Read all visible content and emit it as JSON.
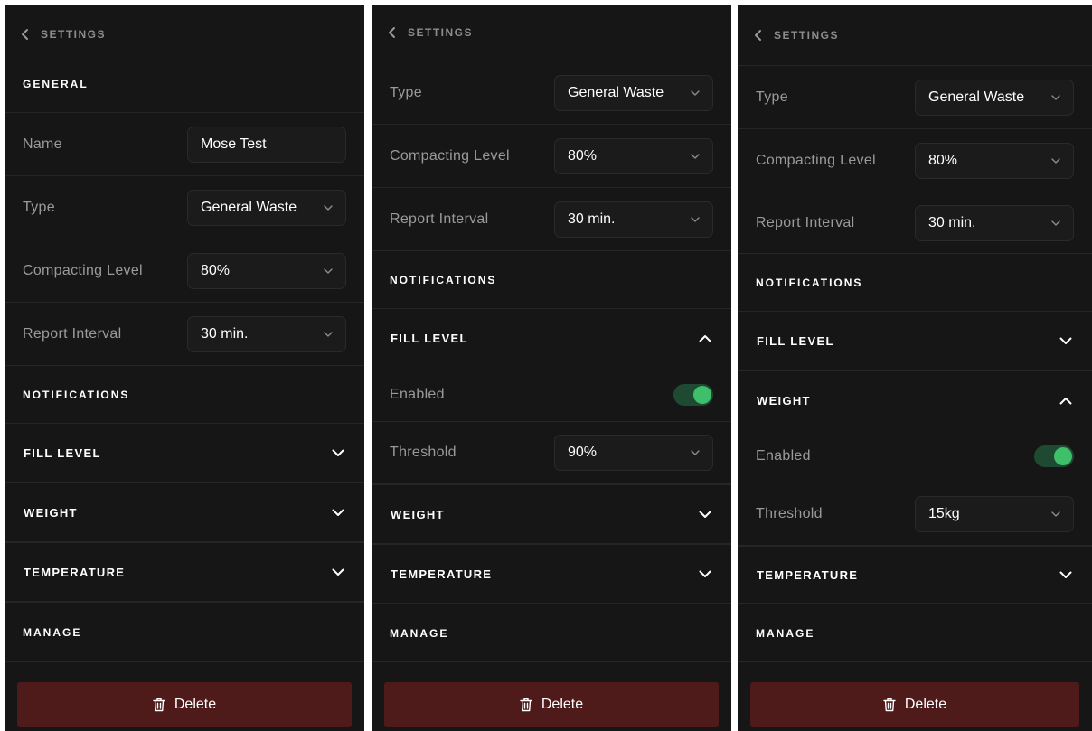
{
  "panels": [
    {
      "header": {
        "back_label": "SETTINGS"
      },
      "general": {
        "title": "GENERAL",
        "name_label": "Name",
        "name_value": "Mose Test"
      },
      "fields": {
        "type_label": "Type",
        "type_value": "General Waste",
        "compacting_label": "Compacting Level",
        "compacting_value": "80%",
        "interval_label": "Report Interval",
        "interval_value": "30 min."
      },
      "notifications_title": "NOTIFICATIONS",
      "fill_level": {
        "label": "FILL LEVEL",
        "expanded": false
      },
      "weight": {
        "label": "WEIGHT",
        "expanded": false
      },
      "temperature": {
        "label": "TEMPERATURE",
        "expanded": false
      },
      "manage_title": "MANAGE",
      "delete_label": "Delete"
    },
    {
      "header": {
        "back_label": "SETTINGS"
      },
      "fields": {
        "type_label": "Type",
        "type_value": "General Waste",
        "compacting_label": "Compacting Level",
        "compacting_value": "80%",
        "interval_label": "Report Interval",
        "interval_value": "30 min."
      },
      "notifications_title": "NOTIFICATIONS",
      "fill_level": {
        "label": "FILL LEVEL",
        "expanded": true,
        "enabled_label": "Enabled",
        "enabled": true,
        "threshold_label": "Threshold",
        "threshold_value": "90%"
      },
      "weight": {
        "label": "WEIGHT",
        "expanded": false
      },
      "temperature": {
        "label": "TEMPERATURE",
        "expanded": false
      },
      "manage_title": "MANAGE",
      "delete_label": "Delete"
    },
    {
      "header": {
        "back_label": "SETTINGS"
      },
      "fields": {
        "type_label": "Type",
        "type_value": "General Waste",
        "compacting_label": "Compacting Level",
        "compacting_value": "80%",
        "interval_label": "Report Interval",
        "interval_value": "30 min."
      },
      "notifications_title": "NOTIFICATIONS",
      "fill_level": {
        "label": "FILL LEVEL",
        "expanded": false
      },
      "weight": {
        "label": "WEIGHT",
        "expanded": true,
        "enabled_label": "Enabled",
        "enabled": true,
        "threshold_label": "Threshold",
        "threshold_value": "15kg"
      },
      "temperature": {
        "label": "TEMPERATURE",
        "expanded": false
      },
      "manage_title": "MANAGE",
      "delete_label": "Delete"
    }
  ],
  "colors": {
    "panel_bg": "#161616",
    "divider": "#262626",
    "toggle_track": "#1f4a32",
    "toggle_knob": "#3fbf6a",
    "delete_bg": "#4e1a1a"
  }
}
